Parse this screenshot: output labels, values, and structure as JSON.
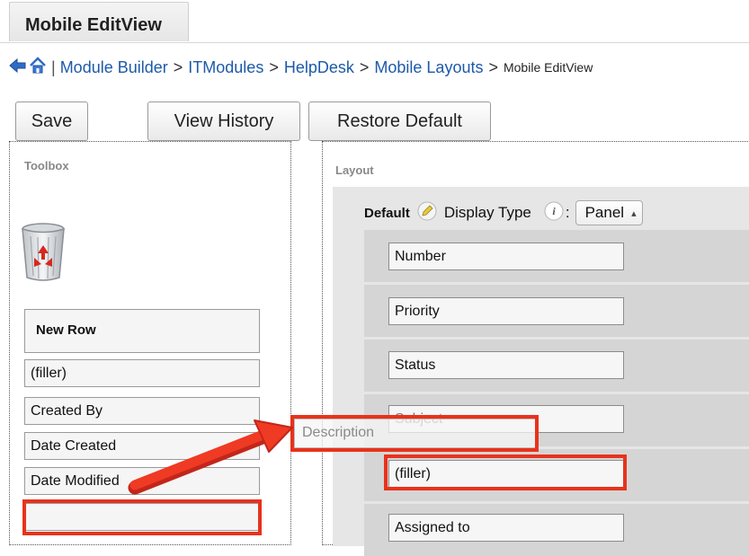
{
  "tab": {
    "label": "Mobile EditView"
  },
  "breadcrumb": {
    "separator": "|",
    "items": [
      "Module Builder",
      "ITModules",
      "HelpDesk",
      "Mobile Layouts"
    ],
    "current": "Mobile EditView"
  },
  "toolbar": {
    "save_label": "Save",
    "view_history_label": "View History",
    "restore_default_label": "Restore Default"
  },
  "toolbox": {
    "title": "Toolbox",
    "new_row_label": "New Row",
    "items": [
      "(filler)",
      "Created By",
      "Date Created",
      "Date Modified",
      ""
    ]
  },
  "layout": {
    "title": "Layout",
    "panel_name": "Default",
    "display_type_label": "Display Type",
    "display_type_sep": ":",
    "display_type_value": "Panel",
    "fields": [
      "Number",
      "Priority",
      "Status",
      "Subject",
      "(filler)",
      "Assigned to"
    ]
  },
  "drag": {
    "label": "Description"
  },
  "colors": {
    "highlight": "#e8321c",
    "link": "#1d5aa8"
  }
}
